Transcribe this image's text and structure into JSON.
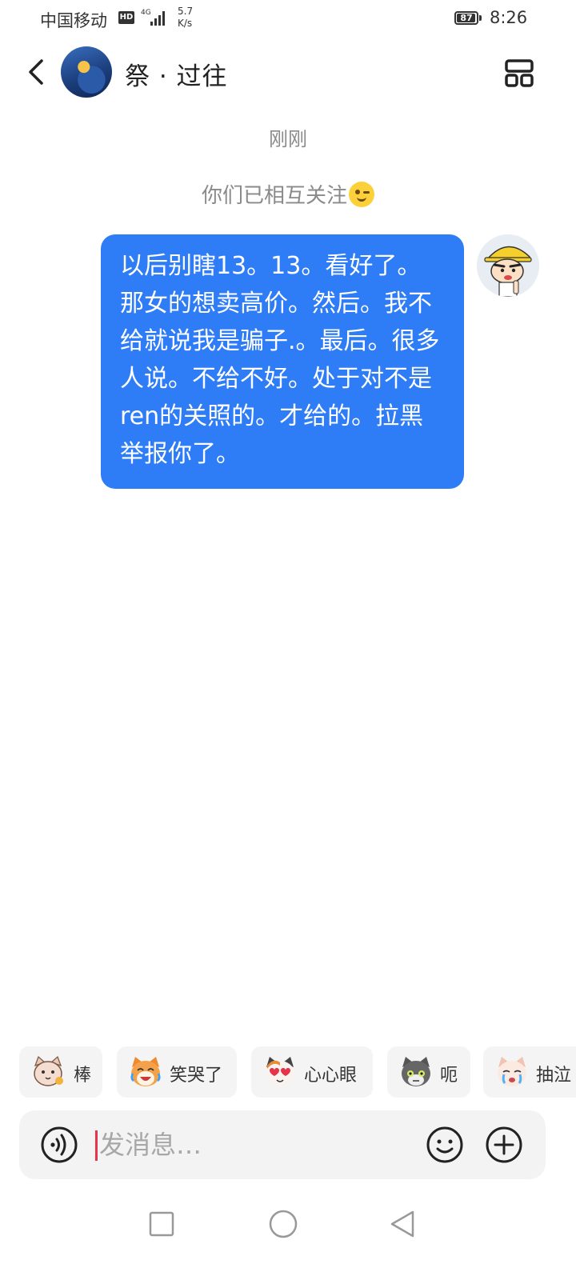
{
  "status_bar": {
    "carrier": "中国移动",
    "hd": "HD",
    "network": "4G",
    "speed_value": "5.7",
    "speed_unit": "K/s",
    "battery": "87",
    "time": "8:26"
  },
  "header": {
    "back_icon": "chevron-left-icon",
    "peer_name": "祭 · 过往",
    "menu_icon": "grid-layout-icon"
  },
  "conversation": {
    "timestamp": "刚刚",
    "system_notice": "你们已相互关注",
    "notice_emoji": "wink-emoji-icon",
    "messages": [
      {
        "sender": "me",
        "text": "以后别瞎13。13。看好了。那女的想卖高价。然后。我不给就说我是骗子.。最后。很多人说。不给不好。处于对不是ren的关照的。才给的。拉黑举报你了。"
      }
    ],
    "bubble_color": "#2e7cf6"
  },
  "sticker_suggestions": [
    {
      "label": "棒",
      "icon": "cat-sticker-icon"
    },
    {
      "label": "笑哭了",
      "icon": "laughing-dog-sticker-icon"
    },
    {
      "label": "心心眼",
      "icon": "heart-eyes-cat-sticker-icon"
    },
    {
      "label": "呃",
      "icon": "gray-cat-sticker-icon"
    },
    {
      "label": "抽泣",
      "icon": "crying-cat-sticker-icon"
    }
  ],
  "input_bar": {
    "placeholder": "发消息…",
    "voice_icon": "voice-icon",
    "emoji_icon": "smiley-icon",
    "plus_icon": "plus-icon"
  },
  "nav_bar": {
    "recents_icon": "square-icon",
    "home_icon": "circle-icon",
    "back_icon": "triangle-back-icon"
  }
}
